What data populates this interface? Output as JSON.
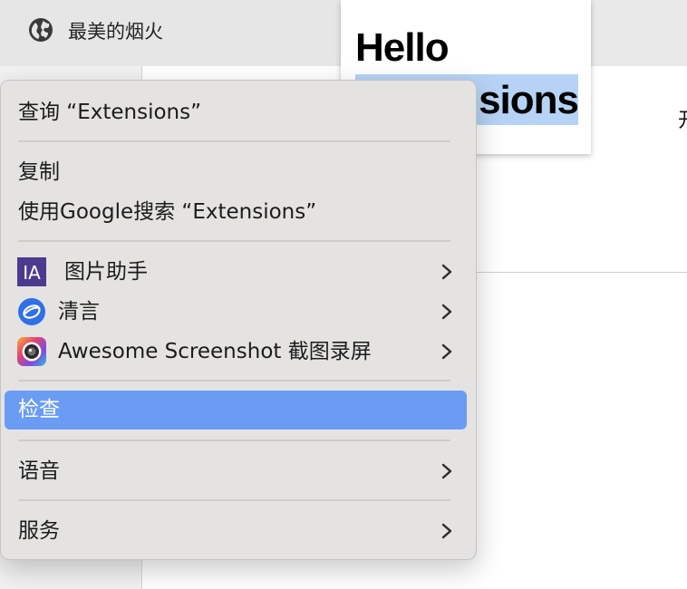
{
  "tab": {
    "title": "最美的烟火",
    "icon": "globe-icon"
  },
  "page": {
    "popup": {
      "line1": "Hello",
      "line2": "sions"
    },
    "side_char": "开"
  },
  "menu": {
    "lookup": "查询 “Extensions”",
    "copy": "复制",
    "search_google": "使用Google搜索 “Extensions”",
    "ext_image_helper": {
      "label": "图片助手",
      "icon": "image-assistant-icon",
      "icon_text": "IA"
    },
    "ext_qingyan": {
      "label": "清言",
      "icon": "qingyan-icon"
    },
    "ext_awesome": {
      "label": "Awesome Screenshot 截图录屏",
      "icon": "camera-lens-icon"
    },
    "inspect": "检查",
    "speech": "语音",
    "services": "服务"
  },
  "colors": {
    "selection": "#6b9cf4",
    "menu_bg": "#e4e3e2",
    "text_highlight": "#b6d3f5"
  }
}
